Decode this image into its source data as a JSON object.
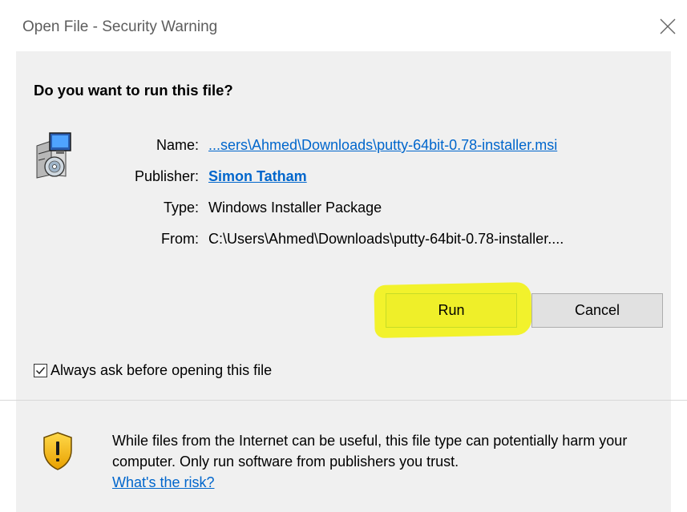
{
  "window": {
    "title": "Open File - Security Warning",
    "close_icon": "close-icon"
  },
  "dialog": {
    "question": "Do you want to run this file?",
    "file_icon": "installer-package-icon",
    "details": {
      "name_label": "Name:",
      "name_value": "...sers\\Ahmed\\Downloads\\putty-64bit-0.78-installer.msi",
      "publisher_label": "Publisher:",
      "publisher_value": "Simon Tatham",
      "type_label": "Type:",
      "type_value": "Windows Installer Package",
      "from_label": "From:",
      "from_value": "C:\\Users\\Ahmed\\Downloads\\putty-64bit-0.78-installer...."
    },
    "buttons": {
      "run_label": "Run",
      "cancel_label": "Cancel"
    },
    "highlight_color": "#f2f200",
    "checkbox": {
      "label": "Always ask before opening this file",
      "checked": true
    }
  },
  "footer": {
    "shield_icon": "warning-shield-icon",
    "warning_text": "While files from the Internet can be useful, this file type can potentially harm your computer. Only run software from publishers you trust.",
    "risk_link": "What's the risk?"
  },
  "colors": {
    "panel": "#f0f0f0",
    "link": "#0066cc",
    "title_text": "#5d5d5d"
  }
}
